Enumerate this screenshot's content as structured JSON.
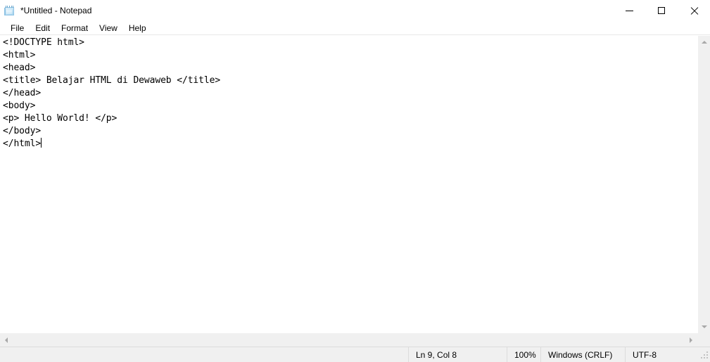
{
  "window": {
    "title": "*Untitled - Notepad",
    "app_icon": "notepad-icon",
    "controls": {
      "minimize": "minimize-icon",
      "maximize": "maximize-icon",
      "close": "close-icon"
    }
  },
  "menubar": {
    "items": [
      {
        "label": "File"
      },
      {
        "label": "Edit"
      },
      {
        "label": "Format"
      },
      {
        "label": "View"
      },
      {
        "label": "Help"
      }
    ]
  },
  "editor": {
    "content": "<!DOCTYPE html>\n<html>\n<head>\n<title> Belajar HTML di Dewaweb </title>\n</head>\n<body>\n<p> Hello World! </p>\n</body>\n</html>",
    "lines": [
      "<!DOCTYPE html>",
      "<html>",
      "<head>",
      "<title> Belajar HTML di Dewaweb </title>",
      "</head>",
      "<body>",
      "<p> Hello World! </p>",
      "</body>",
      "</html>"
    ]
  },
  "scrollbars": {
    "vertical": {
      "up_arrow": "scroll-up-icon",
      "down_arrow": "scroll-down-icon"
    },
    "horizontal": {
      "left_arrow": "scroll-left-icon",
      "right_arrow": "scroll-right-icon"
    }
  },
  "statusbar": {
    "cursor_position": "Ln 9, Col 8",
    "zoom": "100%",
    "line_ending": "Windows (CRLF)",
    "encoding": "UTF-8"
  },
  "colors": {
    "window_bg": "#ffffff",
    "status_bg": "#f0f0f0",
    "scrollbar_bg": "#f0f0f0",
    "border": "#dcdcdc",
    "text": "#000000",
    "close_hover": "#e81123"
  }
}
